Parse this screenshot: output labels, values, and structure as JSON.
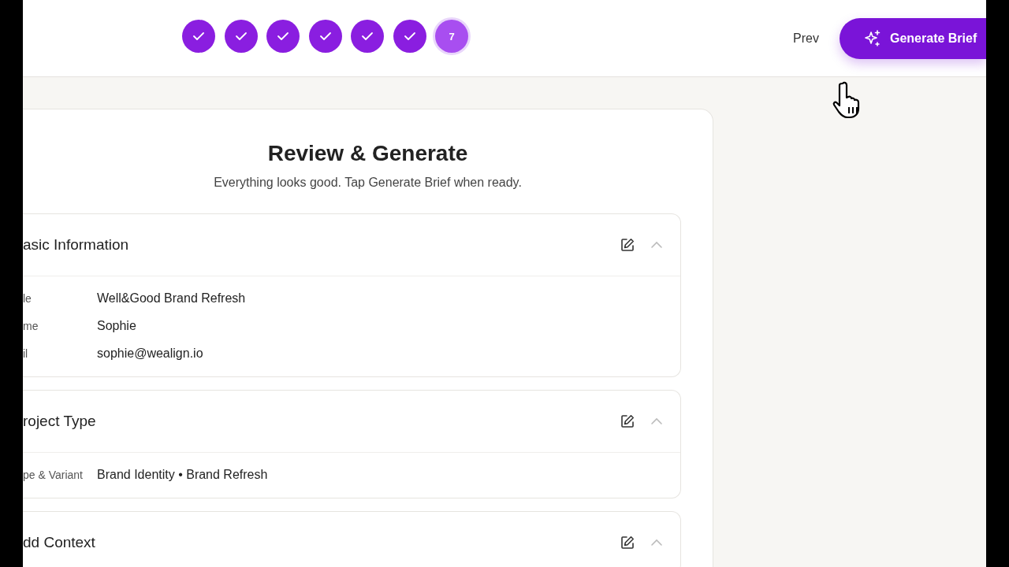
{
  "stepper": {
    "steps": [
      {
        "done": true
      },
      {
        "done": true
      },
      {
        "done": true
      },
      {
        "done": true
      },
      {
        "done": true
      },
      {
        "done": true
      },
      {
        "done": false,
        "label": "7"
      }
    ]
  },
  "actions": {
    "prev": "Prev",
    "primary": "Generate Brief"
  },
  "review": {
    "title": "Review & Generate",
    "subtitle": "Everything looks good. Tap Generate Brief when ready.",
    "sections": [
      {
        "title": "asic Information",
        "expanded": true,
        "rows": [
          {
            "label": "le",
            "value": "Well&Good Brand Refresh"
          },
          {
            "label": "me",
            "value": "Sophie"
          },
          {
            "label": "il",
            "value": "sophie@wealign.io"
          }
        ]
      },
      {
        "title": "roject Type",
        "expanded": true,
        "rows": [
          {
            "label": "pe & Variant",
            "value": "Brand Identity • Brand Refresh"
          }
        ]
      },
      {
        "title": "dd Context",
        "expanded": true
      }
    ]
  }
}
